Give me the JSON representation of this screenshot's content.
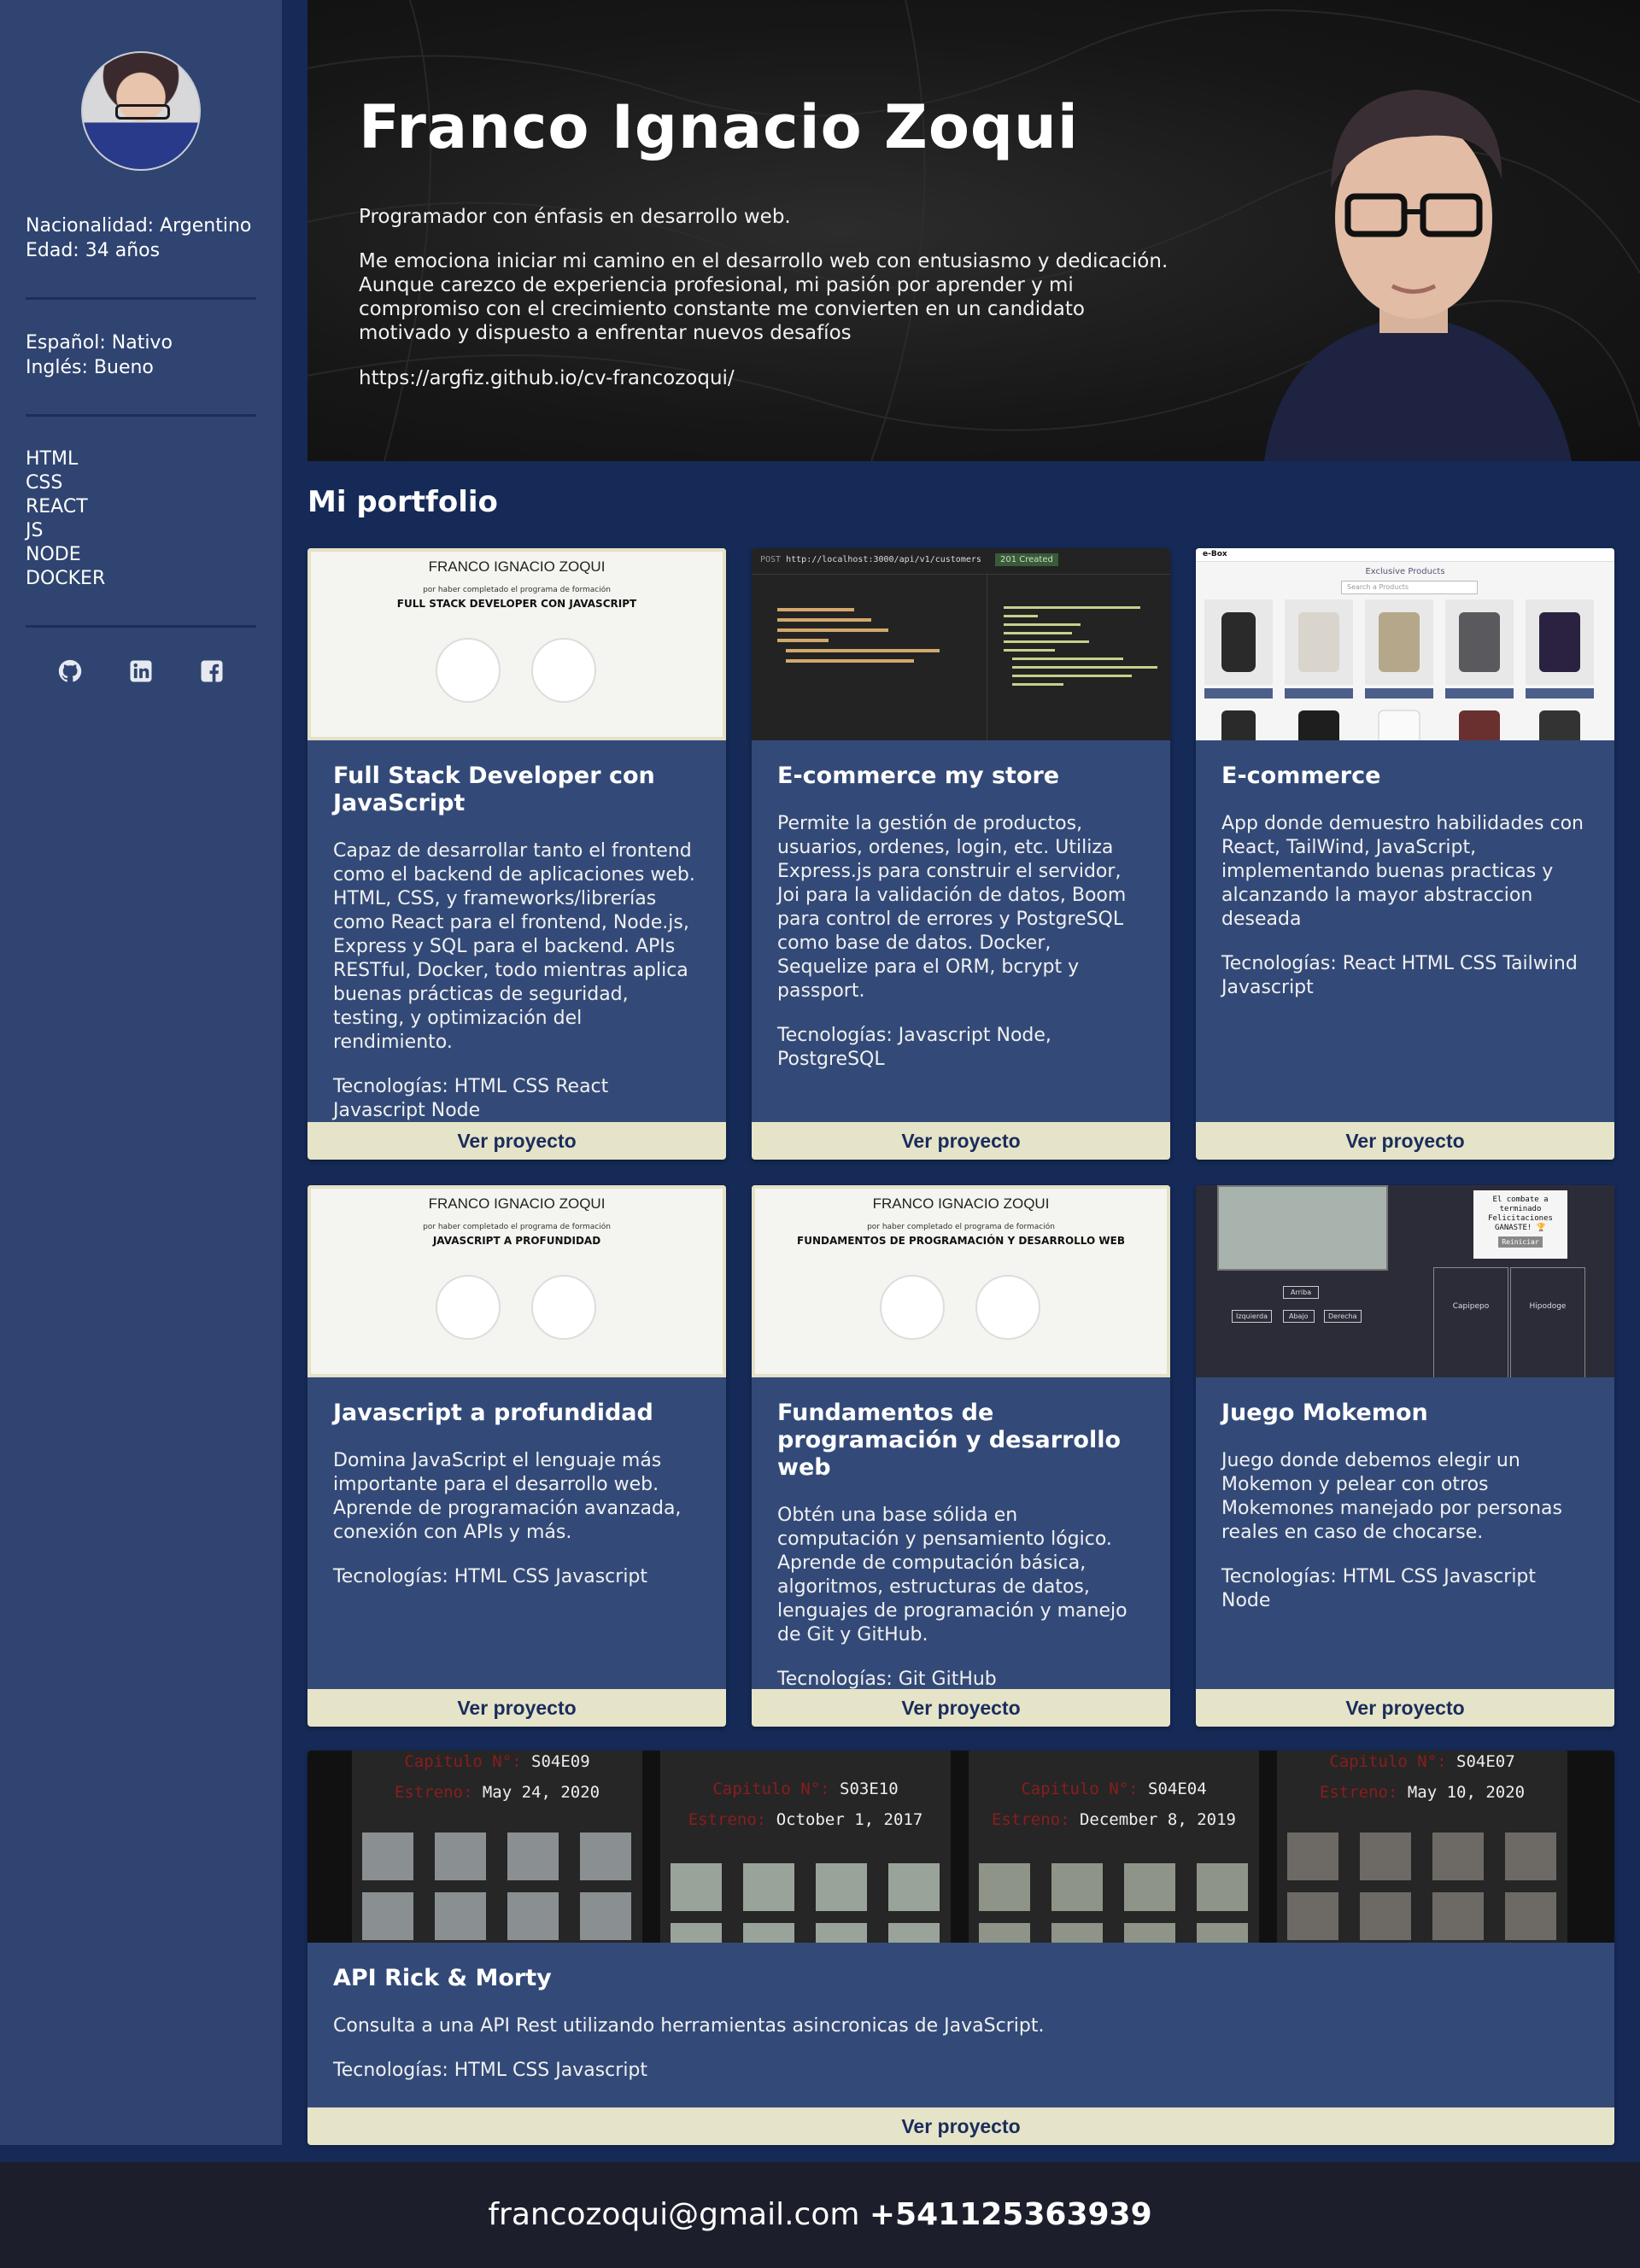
{
  "sidebar": {
    "nationality_label": "Nacionalidad:",
    "nationality": "Argentino",
    "age_label": "Edad:",
    "age": "34 años",
    "lang1_label": "Español:",
    "lang1": "Nativo",
    "lang2_label": "Inglés:",
    "lang2": "Bueno",
    "skills": [
      "HTML",
      "CSS",
      "REACT",
      "JS",
      "NODE",
      "DOCKER"
    ],
    "socials": [
      "github-icon",
      "linkedin-icon",
      "facebook-icon"
    ]
  },
  "hero": {
    "name": "Franco Ignacio Zoqui",
    "tagline": "Programador con énfasis en desarrollo web.",
    "bio": "Me emociona iniciar mi camino en el desarrollo web con entusiasmo y dedicación. Aunque carezco de experiencia profesional, mi pasión por aprender y mi compromiso con el crecimiento constante me convierten en un candidato motivado y dispuesto a enfrentar nuevos desafíos",
    "url": "https://argfiz.github.io/cv-francozoqui/"
  },
  "portfolio": {
    "title": "Mi portfolio",
    "button_label": "Ver proyecto",
    "tech_label": "Tecnologías:",
    "projects": [
      {
        "title": "Full Stack Developer con JavaScript",
        "description": "Capaz de desarrollar tanto el frontend como el backend de aplicaciones web. HTML, CSS, y frameworks/librerías como React para el frontend, Node.js, Express y SQL para el backend. APIs RESTful, Docker, todo mientras aplica buenas prácticas de seguridad, testing, y optimización del rendimiento.",
        "tech": "HTML CSS React Javascript Node",
        "thumb": {
          "cert_title": "FRANCO IGNACIO ZOQUI",
          "cert_sub": "por haber completado el programa de formación",
          "cert_name": "FULL STACK DEVELOPER CON JAVASCRIPT"
        }
      },
      {
        "title": "E-commerce my store",
        "description": "Permite la gestión de productos, usuarios, ordenes, login, etc. Utiliza Express.js para construir el servidor, Joi para la validación de datos, Boom para control de errores y PostgreSQL como base de datos. Docker, Sequelize para el ORM, bcrypt y passport.",
        "tech": "Javascript Node, PostgreSQL",
        "thumb": {
          "method": "POST",
          "url": "http://localhost:3000/api/v1/customers",
          "status": "201 Created"
        }
      },
      {
        "title": "E-commerce",
        "description": "App donde demuestro habilidades con React, TailWind, JavaScript, implementando buenas practicas y alcanzando la mayor abstraccion deseada",
        "tech": "React HTML CSS Tailwind Javascript",
        "thumb": {
          "logo": "e-Box",
          "heading": "Exclusive Products",
          "search": "Search a Products"
        }
      },
      {
        "title": "Javascript a profundidad",
        "description": "Domina JavaScript el lenguaje más importante para el desarrollo web. Aprende de programación avanzada, conexión con APIs y más.",
        "tech": "HTML CSS Javascript",
        "thumb": {
          "cert_title": "FRANCO IGNACIO ZOQUI",
          "cert_sub": "por haber completado el programa de formación",
          "cert_name": "JAVASCRIPT A PROFUNDIDAD"
        }
      },
      {
        "title": "Fundamentos de programación y desarrollo web",
        "description": "Obtén una base sólida en computación y pensamiento lógico. Aprende de computación básica, algoritmos, estructuras de datos, lenguajes de programación y manejo de Git y GitHub.",
        "tech": "Git GitHub",
        "thumb": {
          "cert_title": "FRANCO IGNACIO ZOQUI",
          "cert_sub": "por haber completado el programa de formación",
          "cert_name": "FUNDAMENTOS DE PROGRAMACIÓN Y DESARROLLO WEB"
        }
      },
      {
        "title": "Juego Mokemon",
        "description": "Juego donde debemos elegir un Mokemon y pelear con otros Mokemones manejado por personas reales en caso de chocarse.",
        "tech": "HTML CSS Javascript Node",
        "thumb": {
          "msg": "El combate a terminado Felicitaciones GANASTE! 🏆",
          "reset": "Reiniciar",
          "up": "Arriba",
          "left": "Izquierda",
          "down": "Abajo",
          "right": "Derecha",
          "p1": "Capipepo",
          "p2": "Hipodoge"
        }
      },
      {
        "title": "API Rick & Morty",
        "description": "Consulta a una API Rest utilizando herramientas asincronicas de JavaScript.",
        "tech": "HTML CSS Javascript",
        "thumb": {
          "episodes": [
            {
              "code": "S04E09",
              "date": "May 24, 2020"
            },
            {
              "code": "S03E10",
              "date": "October 1, 2017"
            },
            {
              "code": "S04E04",
              "date": "December 8, 2019"
            },
            {
              "code": "S04E07",
              "date": "May 10, 2020"
            }
          ],
          "ep_label": "Capitulo N°:",
          "date_label": "Estreno:"
        }
      }
    ]
  },
  "footer": {
    "email": "francozoqui@gmail.com",
    "phone": "+541125363939"
  },
  "colors": {
    "background": "#162a57",
    "sidebar": "#2f4470",
    "card": "#334a78",
    "button": "#e6e4c8",
    "button_text": "#1a2d5c",
    "footer": "#1c1f2b"
  }
}
